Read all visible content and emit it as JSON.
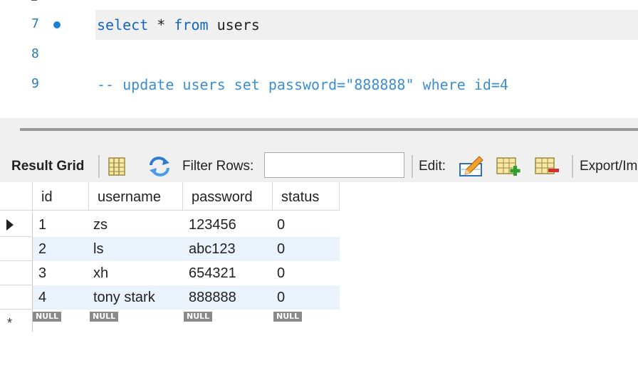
{
  "editor": {
    "lines": [
      {
        "num": "7",
        "kw1": "select",
        "t1": " * ",
        "kw2": "from",
        "t2": " users"
      },
      {
        "num": "8"
      },
      {
        "num": "9",
        "comment": "-- update users set password=\"888888\" where id=4"
      }
    ]
  },
  "toolbar": {
    "result_grid": "Result Grid",
    "filter_label": "Filter Rows:",
    "filter_value": "",
    "edit_label": "Edit:",
    "export_label": "Export/Im"
  },
  "grid": {
    "columns": [
      "id",
      "username",
      "password",
      "status"
    ],
    "rows": [
      [
        "1",
        "zs",
        "123456",
        "0"
      ],
      [
        "2",
        "ls",
        "abc123",
        "0"
      ],
      [
        "3",
        "xh",
        "654321",
        "0"
      ],
      [
        "4",
        "tony stark",
        "888888",
        "0"
      ]
    ],
    "null_label": "NULL",
    "new_row_marker": "*"
  },
  "colors": {
    "keyword": "#1565c0",
    "comment": "#3d8fd1",
    "line_number": "#2b7cb4",
    "alt_row": "#eaf2fc"
  },
  "icons": [
    "form-editor-icon",
    "refresh-icon",
    "edit-pencil-icon",
    "add-row-icon",
    "delete-row-icon",
    "row-selector-arrow-icon",
    "breakpoint-dot-icon"
  ]
}
